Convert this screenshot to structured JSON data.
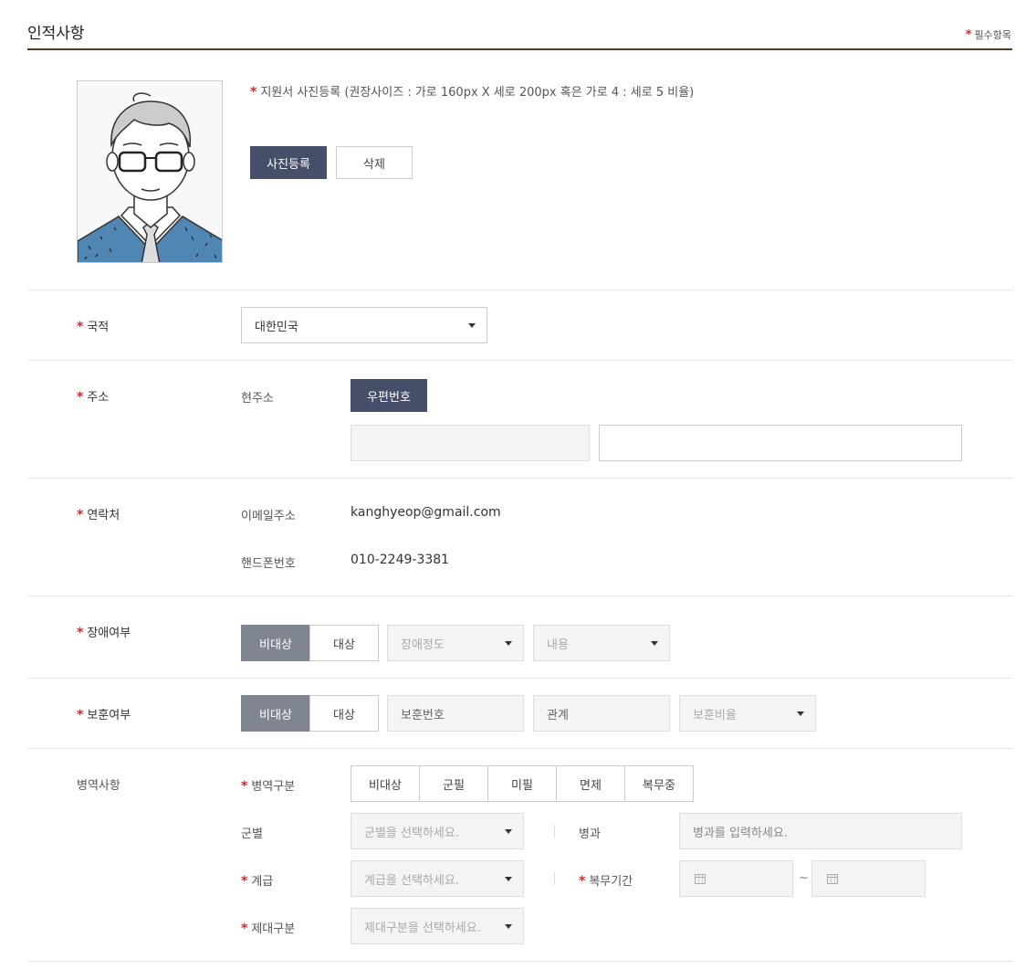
{
  "header": {
    "title": "인적사항",
    "required_star": "*",
    "required_note": "필수항목"
  },
  "photo": {
    "guide_star": "*",
    "guide": "지원서 사진등록 (권장사이즈 : 가로 160px X 세로 200px 혹은 가로 4 : 세로 5 비율)",
    "register_label": "사진등록",
    "delete_label": "삭제"
  },
  "nationality": {
    "star": "*",
    "label": "국적",
    "selected": "대한민국"
  },
  "address": {
    "star": "*",
    "label": "주소",
    "current_label": "현주소",
    "zip_button": "우편번호",
    "address_value": "",
    "detail_value": ""
  },
  "contact": {
    "star": "*",
    "label": "연락처",
    "email_label": "이메일주소",
    "email": "kanghyeop@gmail.com",
    "phone_label": "핸드폰번호",
    "phone": "010-2249-3381"
  },
  "disability": {
    "star": "*",
    "label": "장애여부",
    "options": [
      "비대상",
      "대상"
    ],
    "selected": "비대상",
    "degree_placeholder": "장애정도",
    "content_placeholder": "내용"
  },
  "veteran": {
    "star": "*",
    "label": "보훈여부",
    "options": [
      "비대상",
      "대상"
    ],
    "selected": "비대상",
    "number_placeholder": "보훈번호",
    "relation_placeholder": "관계",
    "ratio_placeholder": "보훈비율"
  },
  "military": {
    "label": "병역사항",
    "type_star": "*",
    "type_label": "병역구분",
    "type_options": [
      "비대상",
      "군필",
      "미필",
      "면제",
      "복무중"
    ],
    "branch_label": "군별",
    "branch_placeholder": "군별을 선택하세요.",
    "specialty_label": "병과",
    "specialty_placeholder": "병과를 입력하세요.",
    "rank_star": "*",
    "rank_label": "계급",
    "rank_placeholder": "계급을 선택하세요.",
    "period_star": "*",
    "period_label": "복무기간",
    "period_sep": "~",
    "discharge_star": "*",
    "discharge_label": "제대구분",
    "discharge_placeholder": "제대구분을 선택하세요."
  },
  "colors": {
    "accent_dark": "#464e6a",
    "selected_gray": "#808691",
    "required": "#d9232b",
    "title_line": "#5c3a21"
  }
}
